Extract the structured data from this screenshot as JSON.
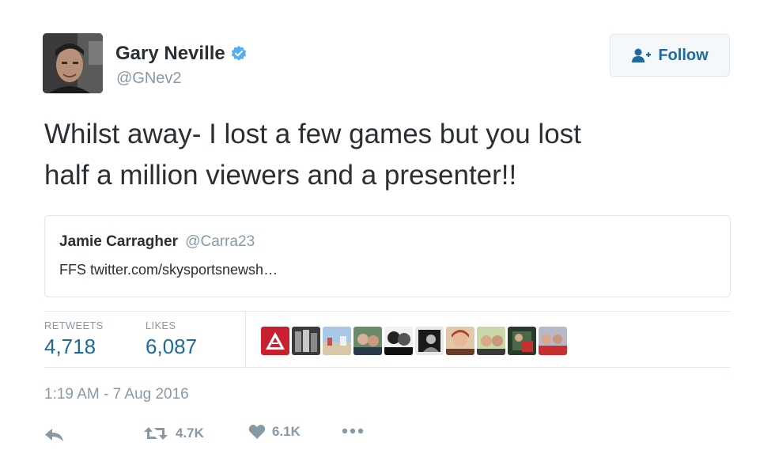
{
  "tweet": {
    "author": {
      "name": "Gary Neville",
      "handle": "@GNev2",
      "verified": true
    },
    "follow_label": "Follow",
    "text_line1": "Whilst away- I lost a few games but you lost",
    "text_line2": "half a million viewers and a presenter!!",
    "quoted": {
      "name": "Jamie Carragher",
      "handle": "@Carra23",
      "text": "FFS twitter.com/skysportsnewsh…"
    },
    "stats": {
      "retweets_label": "RETWEETS",
      "retweets": "4,718",
      "likes_label": "LIKES",
      "likes": "6,087"
    },
    "timestamp": "1:19 AM - 7 Aug 2016",
    "actions": {
      "retweet_count": "4.7K",
      "like_count": "6.1K"
    }
  },
  "colors": {
    "link": "#1c6aa0",
    "muted": "#8899a6",
    "text": "#292f33",
    "verified": "#55acee",
    "border": "#e1e8ed"
  },
  "icons": [
    "verified-badge-icon",
    "follow-user-icon",
    "reply-icon",
    "retweet-icon",
    "heart-icon",
    "more-icon"
  ]
}
